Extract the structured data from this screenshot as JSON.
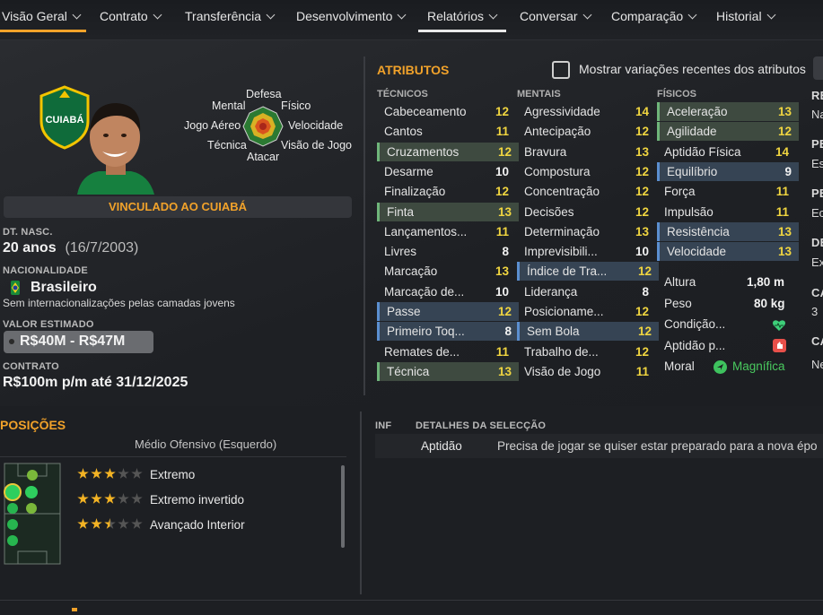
{
  "nav": {
    "tabs": [
      {
        "label": "Visão Geral"
      },
      {
        "label": "Contrato"
      },
      {
        "label": "Transferência"
      },
      {
        "label": "Desenvolvimento"
      },
      {
        "label": "Relatórios"
      },
      {
        "label": "Conversar"
      },
      {
        "label": "Comparação"
      },
      {
        "label": "Historial"
      }
    ],
    "active_color": "#f1a22a",
    "selected_color": "#e8e8e8"
  },
  "profile": {
    "club_badge_text": "CUIABÁ",
    "status_banner": "VINCULADO AO CUIABÁ",
    "dob_label": "DT. NASC.",
    "age": "20 anos",
    "dob": "(16/7/2003)",
    "nationality_label": "NACIONALIDADE",
    "nationality": "Brasileiro",
    "intl_note": "Sem internacionalizações pelas camadas jovens",
    "value_label": "VALOR ESTIMADO",
    "value": "R$40M - R$47M",
    "contract_label": "CONTRATO",
    "contract": "R$100m p/m até 31/12/2025"
  },
  "radar": {
    "labels": {
      "defesa": "Defesa",
      "fisico": "Físico",
      "mental": "Mental",
      "velocidade": "Velocidade",
      "jogo_aereo": "Jogo Aéreo",
      "visao": "Visão de Jogo",
      "tecnica": "Técnica",
      "atacar": "Atacar"
    }
  },
  "attributes": {
    "title": "ATRIBUTOS",
    "toggle_label": "Mostrar variações recentes dos atributos",
    "toggle_checked": false,
    "tecnicos": {
      "header": "TÉCNICOS",
      "items": [
        {
          "name": "Cabeceamento",
          "value": "12",
          "hl": ""
        },
        {
          "name": "Cantos",
          "value": "11",
          "hl": ""
        },
        {
          "name": "Cruzamentos",
          "value": "12",
          "hl": "g"
        },
        {
          "name": "Desarme",
          "value": "10",
          "hl": ""
        },
        {
          "name": "Finalização",
          "value": "12",
          "hl": ""
        },
        {
          "name": "Finta",
          "value": "13",
          "hl": "g"
        },
        {
          "name": "Lançamentos...",
          "value": "11",
          "hl": ""
        },
        {
          "name": "Livres",
          "value": "8",
          "hl": ""
        },
        {
          "name": "Marcação",
          "value": "13",
          "hl": ""
        },
        {
          "name": "Marcação de...",
          "value": "10",
          "hl": ""
        },
        {
          "name": "Passe",
          "value": "12",
          "hl": "b"
        },
        {
          "name": "Primeiro Toq...",
          "value": "8",
          "hl": "b"
        },
        {
          "name": "Remates de...",
          "value": "11",
          "hl": ""
        },
        {
          "name": "Técnica",
          "value": "13",
          "hl": "g"
        }
      ]
    },
    "mentais": {
      "header": "MENTAIS",
      "items": [
        {
          "name": "Agressividade",
          "value": "14",
          "hl": ""
        },
        {
          "name": "Antecipação",
          "value": "12",
          "hl": ""
        },
        {
          "name": "Bravura",
          "value": "13",
          "hl": ""
        },
        {
          "name": "Compostura",
          "value": "12",
          "hl": ""
        },
        {
          "name": "Concentração",
          "value": "12",
          "hl": ""
        },
        {
          "name": "Decisões",
          "value": "12",
          "hl": ""
        },
        {
          "name": "Determinação",
          "value": "13",
          "hl": ""
        },
        {
          "name": "Imprevisibili...",
          "value": "10",
          "hl": ""
        },
        {
          "name": "Índice de Tra...",
          "value": "12",
          "hl": "b"
        },
        {
          "name": "Liderança",
          "value": "8",
          "hl": ""
        },
        {
          "name": "Posicioname...",
          "value": "12",
          "hl": ""
        },
        {
          "name": "Sem Bola",
          "value": "12",
          "hl": "b"
        },
        {
          "name": "Trabalho de...",
          "value": "12",
          "hl": ""
        },
        {
          "name": "Visão de Jogo",
          "value": "11",
          "hl": ""
        }
      ]
    },
    "fisicos": {
      "header": "FÍSICOS",
      "items": [
        {
          "name": "Aceleração",
          "value": "13",
          "hl": "g"
        },
        {
          "name": "Agilidade",
          "value": "12",
          "hl": "g"
        },
        {
          "name": "Aptidão Física",
          "value": "14",
          "hl": ""
        },
        {
          "name": "Equilíbrio",
          "value": "9",
          "hl": "b"
        },
        {
          "name": "Força",
          "value": "11",
          "hl": ""
        },
        {
          "name": "Impulsão",
          "value": "11",
          "hl": ""
        },
        {
          "name": "Resistência",
          "value": "13",
          "hl": "b"
        },
        {
          "name": "Velocidade",
          "value": "13",
          "hl": "b"
        }
      ]
    },
    "extra": {
      "height_label": "Altura",
      "height": "1,80 m",
      "weight_label": "Peso",
      "weight": "80 kg",
      "condition_label": "Condição...",
      "fitness_label": "Aptidão p...",
      "morale_label": "Moral",
      "morale": "Magnífica"
    }
  },
  "right_cut": {
    "labels": [
      "RE",
      "Na",
      "PE",
      "Es",
      "PE",
      "Ec",
      "DE",
      "Ex",
      "CA",
      "3",
      "CA",
      "Ne"
    ]
  },
  "positions": {
    "title": "POSIÇÕES",
    "main_position": "Médio Ofensivo (Esquerdo)",
    "roles": [
      {
        "name": "Extremo",
        "stars": 3
      },
      {
        "name": "Extremo invertido",
        "stars": 3
      },
      {
        "name": "Avançado Interior",
        "stars": 2.5
      }
    ]
  },
  "selection": {
    "inf_label": "INF",
    "header": "DETALHES DA SELECÇÃO",
    "row_label": "Aptidão",
    "row_text": "Precisa de jogar se quiser estar preparado para a nova épo"
  }
}
